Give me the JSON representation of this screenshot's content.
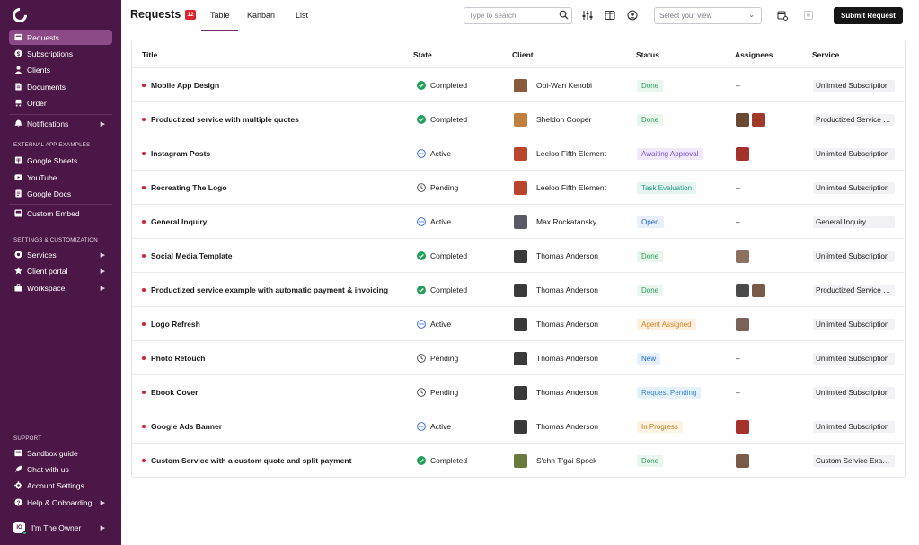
{
  "sidebar": {
    "primary": [
      {
        "label": "Requests",
        "icon": "inbox-icon",
        "active": true
      },
      {
        "label": "Subscriptions",
        "icon": "dollar-icon"
      },
      {
        "label": "Clients",
        "icon": "user-icon"
      },
      {
        "label": "Documents",
        "icon": "document-icon"
      },
      {
        "label": "Order",
        "icon": "cart-icon"
      }
    ],
    "notifications": {
      "label": "Notifications",
      "icon": "bell-icon"
    },
    "external_section": "EXTERNAL APP EXAMPLES",
    "external": [
      {
        "label": "Google Sheets",
        "icon": "sheet-icon"
      },
      {
        "label": "YouTube",
        "icon": "play-icon"
      },
      {
        "label": "Google Docs",
        "icon": "doc-icon"
      }
    ],
    "custom_embed": {
      "label": "Custom Embed",
      "icon": "embed-icon"
    },
    "settings_section": "SETTINGS & CUSTOMIZATION",
    "settings": [
      {
        "label": "Services",
        "icon": "grid-icon"
      },
      {
        "label": "Client portal",
        "icon": "star-icon"
      },
      {
        "label": "Workspace",
        "icon": "briefcase-icon"
      }
    ],
    "support_section": "SUPPORT",
    "support": [
      {
        "label": "Sandbox guide",
        "icon": "box-icon"
      },
      {
        "label": "Chat with us",
        "icon": "rocket-icon"
      },
      {
        "label": "Account Settings",
        "icon": "gear-icon"
      },
      {
        "label": "Help & Onboarding",
        "icon": "help-icon"
      }
    ],
    "owner": {
      "label": "I'm The Owner",
      "initials": "IO"
    }
  },
  "header": {
    "title": "Requests",
    "count": "12",
    "tabs": [
      "Table",
      "Kanban",
      "List"
    ],
    "active_tab": "Table",
    "search_placeholder": "Type to search",
    "view_placeholder": "Select your view",
    "submit_label": "Submit Request"
  },
  "table": {
    "columns": [
      "Title",
      "State",
      "Client",
      "Status",
      "Assignees",
      "Service"
    ],
    "rows": [
      {
        "title": "Mobile App Design",
        "state": "Completed",
        "client": "Obi-Wan Kenobi",
        "client_color": "#8a5a3c",
        "status": "Done",
        "assignees": "–",
        "assignee_colors": [],
        "service": "Unlimited Subscription"
      },
      {
        "title": "Productized service with multiple quotes",
        "state": "Completed",
        "client": "Sheldon Cooper",
        "client_color": "#c08040",
        "status": "Done",
        "assignees": "",
        "assignee_colors": [
          "#6b4a35",
          "#a13a2a"
        ],
        "service": "Productized Service Example"
      },
      {
        "title": "Instagram Posts",
        "state": "Active",
        "client": "Leeloo Fifth Element",
        "client_color": "#b8452c",
        "status": "Awaiting Approval",
        "assignees": "",
        "assignee_colors": [
          "#a5322a"
        ],
        "service": "Unlimited Subscription"
      },
      {
        "title": "Recreating The Logo",
        "state": "Pending",
        "client": "Leeloo Fifth Element",
        "client_color": "#b8452c",
        "status": "Task Evaluation",
        "assignees": "–",
        "assignee_colors": [],
        "service": "Unlimited Subscription"
      },
      {
        "title": "General Inquiry",
        "state": "Active",
        "client": "Max Rockatansky",
        "client_color": "#5a5a66",
        "status": "Open",
        "assignees": "–",
        "assignee_colors": [],
        "service": "General Inquiry"
      },
      {
        "title": "Social Media Template",
        "state": "Completed",
        "client": "Thomas Anderson",
        "client_color": "#3a3a3a",
        "status": "Done",
        "assignees": "",
        "assignee_colors": [
          "#8c7060"
        ],
        "service": "Unlimited Subscription"
      },
      {
        "title": "Productized service example with automatic payment & invoicing",
        "state": "Completed",
        "client": "Thomas Anderson",
        "client_color": "#3a3a3a",
        "status": "Done",
        "assignees": "",
        "assignee_colors": [
          "#4a4a4a",
          "#7a5a48"
        ],
        "service": "Productized Service Example"
      },
      {
        "title": "Logo Refresh",
        "state": "Active",
        "client": "Thomas Anderson",
        "client_color": "#3a3a3a",
        "status": "Agent Assigned",
        "assignees": "",
        "assignee_colors": [
          "#7a6258"
        ],
        "service": "Unlimited Subscription"
      },
      {
        "title": "Photo Retouch",
        "state": "Pending",
        "client": "Thomas Anderson",
        "client_color": "#3a3a3a",
        "status": "New",
        "assignees": "–",
        "assignee_colors": [],
        "service": "Unlimited Subscription"
      },
      {
        "title": "Ebook Cover",
        "state": "Pending",
        "client": "Thomas Anderson",
        "client_color": "#3a3a3a",
        "status": "Request Pending",
        "assignees": "–",
        "assignee_colors": [],
        "service": "Unlimited Subscription"
      },
      {
        "title": "Google Ads Banner",
        "state": "Active",
        "client": "Thomas Anderson",
        "client_color": "#3a3a3a",
        "status": "In Progress",
        "assignees": "",
        "assignee_colors": [
          "#a5322a"
        ],
        "service": "Unlimited Subscription"
      },
      {
        "title": "Custom Service with a custom quote and split payment",
        "state": "Completed",
        "client": "S'chn T'gai Spock",
        "client_color": "#6a7a3a",
        "status": "Done",
        "assignees": "",
        "assignee_colors": [
          "#7a5a48"
        ],
        "service": "Custom Service Example"
      }
    ]
  },
  "status_styles": {
    "Done": {
      "bg": "#e8f6ee",
      "fg": "#2e9e5b"
    },
    "Awaiting Approval": {
      "bg": "#efe9fb",
      "fg": "#7b4fd6"
    },
    "Task Evaluation": {
      "bg": "#e5f6f2",
      "fg": "#1f9c84"
    },
    "Open": {
      "bg": "#e7f0fc",
      "fg": "#2367c9"
    },
    "Agent Assigned": {
      "bg": "#fdf0e1",
      "fg": "#d9801f"
    },
    "New": {
      "bg": "#e7f0fc",
      "fg": "#2367c9"
    },
    "Request Pending": {
      "bg": "#e5f1fb",
      "fg": "#3a87cf"
    },
    "In Progress": {
      "bg": "#fdf3e3",
      "fg": "#c07a1a"
    }
  },
  "state_colors": {
    "Completed": "#22a05a",
    "Active": "#3a6fd8",
    "Pending": "#555555"
  }
}
